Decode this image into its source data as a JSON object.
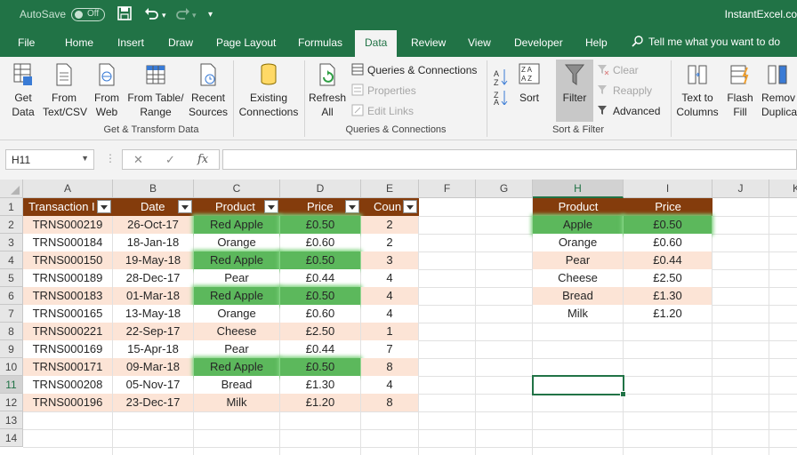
{
  "titlebar": {
    "autosave_label": "AutoSave",
    "autosave_state": "Off",
    "app_name": "InstantExcel.co"
  },
  "tabs": [
    {
      "label": "File"
    },
    {
      "label": "Home"
    },
    {
      "label": "Insert"
    },
    {
      "label": "Draw"
    },
    {
      "label": "Page Layout"
    },
    {
      "label": "Formulas"
    },
    {
      "label": "Data",
      "active": true
    },
    {
      "label": "Review"
    },
    {
      "label": "View"
    },
    {
      "label": "Developer"
    },
    {
      "label": "Help"
    }
  ],
  "tell_me": "Tell me what you want to do",
  "ribbon": {
    "get_data": "Get\nData",
    "from_text_csv": "From\nText/CSV",
    "from_web": "From\nWeb",
    "from_table_range": "From Table/\nRange",
    "recent_sources": "Recent\nSources",
    "existing_connections": "Existing\nConnections",
    "group_get_transform": "Get & Transform Data",
    "refresh_all": "Refresh\nAll",
    "queries_connections": "Queries & Connections",
    "properties": "Properties",
    "edit_links": "Edit Links",
    "group_queries": "Queries & Connections",
    "sort": "Sort",
    "filter": "Filter",
    "clear": "Clear",
    "reapply": "Reapply",
    "advanced": "Advanced",
    "group_sort_filter": "Sort & Filter",
    "text_to_columns": "Text to\nColumns",
    "flash_fill": "Flash\nFill",
    "remove_duplicates": "Remov\nDuplica"
  },
  "formula_bar": {
    "name_box": "H11",
    "fx": "fx",
    "formula": ""
  },
  "columns": [
    "A",
    "B",
    "C",
    "D",
    "E",
    "F",
    "G",
    "H",
    "I",
    "J",
    "K"
  ],
  "rows": [
    "1",
    "2",
    "3",
    "4",
    "5",
    "6",
    "7",
    "8",
    "9",
    "10",
    "11",
    "12",
    "13",
    "14"
  ],
  "main_table": {
    "headers": [
      "Transaction I",
      "Date",
      "Product",
      "Price",
      "Coun"
    ],
    "rows": [
      {
        "id": "TRNS000219",
        "date": "26-Oct-17",
        "product": "Red Apple",
        "price": "£0.50",
        "count": "2",
        "highlight": true
      },
      {
        "id": "TRNS000184",
        "date": "18-Jan-18",
        "product": "Orange",
        "price": "£0.60",
        "count": "2",
        "highlight": false
      },
      {
        "id": "TRNS000150",
        "date": "19-May-18",
        "product": "Red Apple",
        "price": "£0.50",
        "count": "3",
        "highlight": true
      },
      {
        "id": "TRNS000189",
        "date": "28-Dec-17",
        "product": "Pear",
        "price": "£0.44",
        "count": "4",
        "highlight": false
      },
      {
        "id": "TRNS000183",
        "date": "01-Mar-18",
        "product": "Red Apple",
        "price": "£0.50",
        "count": "4",
        "highlight": true
      },
      {
        "id": "TRNS000165",
        "date": "13-May-18",
        "product": "Orange",
        "price": "£0.60",
        "count": "4",
        "highlight": false
      },
      {
        "id": "TRNS000221",
        "date": "22-Sep-17",
        "product": "Cheese",
        "price": "£2.50",
        "count": "1",
        "highlight": false
      },
      {
        "id": "TRNS000169",
        "date": "15-Apr-18",
        "product": "Pear",
        "price": "£0.44",
        "count": "7",
        "highlight": false
      },
      {
        "id": "TRNS000171",
        "date": "09-Mar-18",
        "product": "Red Apple",
        "price": "£0.50",
        "count": "8",
        "highlight": true
      },
      {
        "id": "TRNS000208",
        "date": "05-Nov-17",
        "product": "Bread",
        "price": "£1.30",
        "count": "4",
        "highlight": false
      },
      {
        "id": "TRNS000196",
        "date": "23-Dec-17",
        "product": "Milk",
        "price": "£1.20",
        "count": "8",
        "highlight": false
      }
    ]
  },
  "lookup_table": {
    "headers": [
      "Product",
      "Price"
    ],
    "rows": [
      {
        "product": "Apple",
        "price": "£0.50",
        "highlight": true
      },
      {
        "product": "Orange",
        "price": "£0.60",
        "highlight": false
      },
      {
        "product": "Pear",
        "price": "£0.44",
        "highlight": false
      },
      {
        "product": "Cheese",
        "price": "£2.50",
        "highlight": false
      },
      {
        "product": "Bread",
        "price": "£1.30",
        "highlight": false
      },
      {
        "product": "Milk",
        "price": "£1.20",
        "highlight": false
      }
    ]
  },
  "colors": {
    "excel_green": "#217346",
    "header_brown": "#843c0c",
    "band_peach": "#fce4d6",
    "highlight_green": "#5cb85c"
  }
}
